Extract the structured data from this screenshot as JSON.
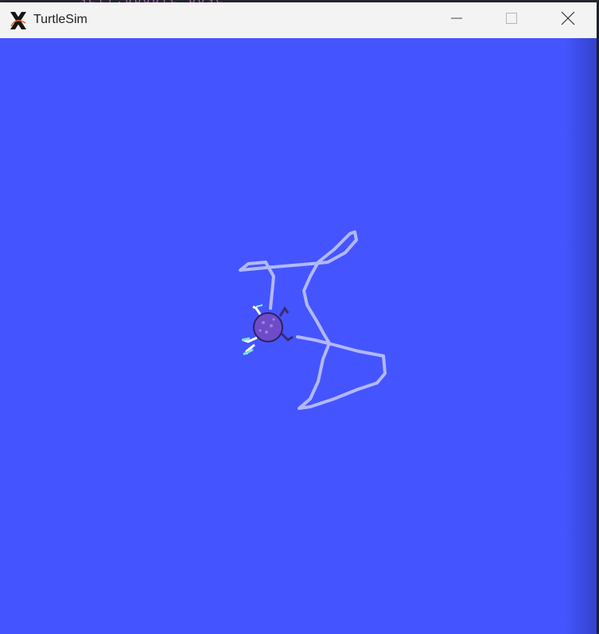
{
  "window": {
    "title": "TurtleSim",
    "buttons": {
      "minimize_icon": "minimize-icon",
      "maximize_icon": "maximize-icon",
      "close_icon": "close-icon"
    }
  },
  "background": {
    "code_fragment": "self.update_pose"
  },
  "canvas": {
    "background_color": "#4455ff",
    "trail_color": "#b3b8ff"
  },
  "turtle": {
    "shell_color": "#6e4cc8",
    "accent_color": "#7fe0d8"
  }
}
